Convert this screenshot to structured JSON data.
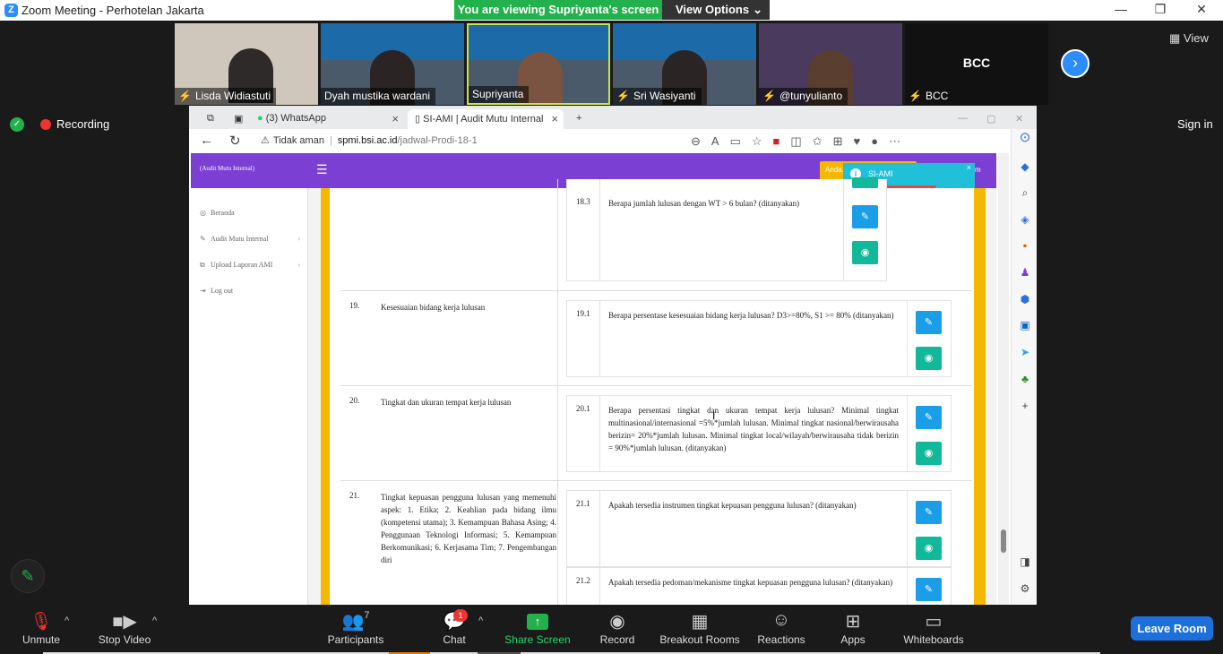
{
  "window": {
    "title": "Zoom Meeting - Perhotelan Jakarta",
    "minimize": "—",
    "restore": "❐",
    "close": "✕"
  },
  "viewing_banner": "You are viewing Supriyanta's screen",
  "view_options": "View Options",
  "gallery_view": "View",
  "participants_strip": [
    {
      "name": "Lisda Widiastuti",
      "muted": true
    },
    {
      "name": "Dyah mustika wardani",
      "muted": false
    },
    {
      "name": "Supriyanta",
      "muted": false
    },
    {
      "name": "Sri Wasiyanti",
      "muted": true
    },
    {
      "name": "@tunyulianto",
      "muted": true
    }
  ],
  "bcc_tile": {
    "label": "BCC",
    "name": "BCC"
  },
  "recording": "Recording",
  "sign_in": "Sign in",
  "browser": {
    "tabs": [
      {
        "label": "(3) WhatsApp"
      },
      {
        "label": "SI-AMI | Audit Mutu Internal"
      }
    ],
    "security_label": "Tidak aman",
    "url_host": "spmi.bsi.ac.id",
    "url_path": "/jadwal-Prodi-18-1"
  },
  "app": {
    "brand": "(Audit Mutu Internal)",
    "user_btn": "Anda...",
    "user_btn2": "m",
    "toast": "SI-AMI",
    "sidebar": [
      {
        "label": "Beranda",
        "icon": "dashboard-icon"
      },
      {
        "label": "Audit Mutu Internal",
        "icon": "edit-icon"
      },
      {
        "label": "Upload Laporan AMI",
        "icon": "upload-icon"
      },
      {
        "label": "Log out",
        "icon": "logout-icon"
      }
    ]
  },
  "rows": [
    {
      "num": "",
      "desc": "",
      "subs": [
        {
          "num": "18.3",
          "text": "Berapa jumlah lulusan dengan WT > 6 bulan? (ditanyakan)"
        }
      ]
    },
    {
      "num": "19.",
      "desc": "Kesesuaian bidang kerja lulusan",
      "subs": [
        {
          "num": "19.1",
          "text": "Berapa persentase kesesuaian bidang kerja lulusan? D3>=80%, S1 >= 80% (ditanyakan)"
        }
      ]
    },
    {
      "num": "20.",
      "desc": "Tingkat dan ukuran tempat kerja lulusan",
      "subs": [
        {
          "num": "20.1",
          "text": "Berapa persentasi tingkat dan ukuran tempat kerja lulusan? Minimal tingkat multinasional/internasional =5%*jumlah lulusan. Minimal tingkat nasional/berwirausaha berizin= 20%*jumlah lulusan. Minimal tingkat local/wilayah/berwirausaha tidak berizin = 90%*jumlah lulusan. (ditanyakan)"
        }
      ]
    },
    {
      "num": "21.",
      "desc": "Tingkat kepuasan pengguna lulusan yang memenuhi aspek: 1. Etika; 2. Keahlian pada bidang ilmu (kompetensi utama); 3. Kemampuan Bahasa Asing; 4. Penggunaan Teknologi Informasi; 5. Kemampuan Berkomunikasi; 6. Kerjasama Tim; 7. Pengembangan diri",
      "subs": [
        {
          "num": "21.1",
          "text": "Apakah tersedia instrumen tingkat kepuasan pengguna lulusan? (ditanyakan)"
        },
        {
          "num": "21.2",
          "text": "Apakah tersedia pedoman/mekanisme tingkat kepuasan pengguna lulusan? (ditanyakan)"
        }
      ]
    }
  ],
  "controls": {
    "unmute": "Unmute",
    "stop_video": "Stop Video",
    "participants": "Participants",
    "participants_count": "7",
    "chat": "Chat",
    "chat_badge": "1",
    "share_screen": "Share Screen",
    "record": "Record",
    "breakout_rooms": "Breakout Rooms",
    "reactions": "Reactions",
    "apps": "Apps",
    "whiteboards": "Whiteboards",
    "leave": "Leave Room"
  },
  "colors": {
    "zoom_blue": "#2d8cff",
    "share_green": "#23b14d",
    "app_purple": "#7b3fd4",
    "app_yellow": "#f5b800",
    "edit_blue": "#1a9ee8",
    "view_teal": "#12b89a",
    "toast_cyan": "#1fc0d8"
  }
}
